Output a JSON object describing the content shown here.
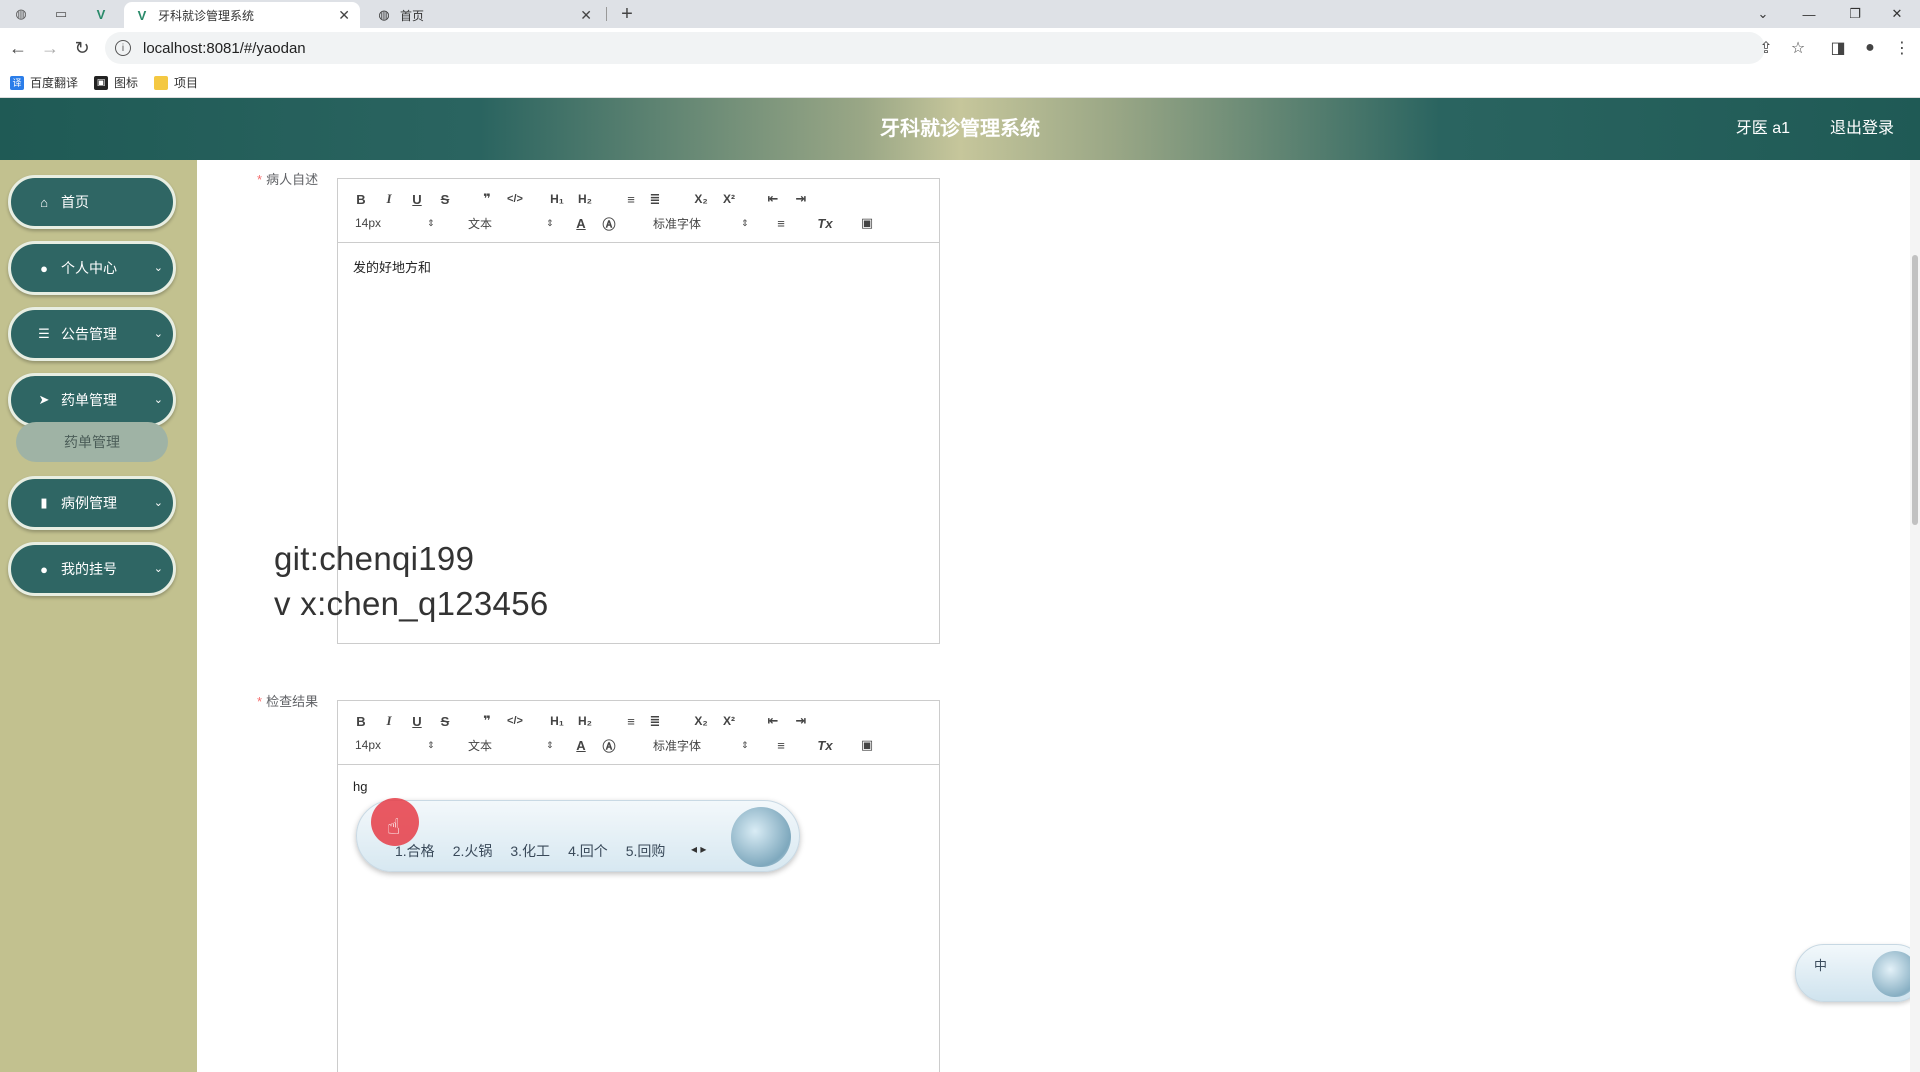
{
  "browser": {
    "tabs": [
      {
        "title": "牙科就诊管理系统",
        "active": true
      },
      {
        "title": "首页",
        "active": false
      }
    ],
    "url": "localhost:8081/#/yaodan",
    "bookmarks": [
      {
        "label": "百度翻译",
        "icon": "translate-icon"
      },
      {
        "label": "图标",
        "icon": "image-icon"
      },
      {
        "label": "项目",
        "icon": "folder-icon"
      }
    ]
  },
  "header": {
    "title": "牙科就诊管理系统",
    "user": "牙医 a1",
    "logout": "退出登录"
  },
  "sidebar": {
    "items": [
      {
        "label": "首页",
        "icon": "home-icon"
      },
      {
        "label": "个人中心",
        "icon": "user-icon"
      },
      {
        "label": "公告管理",
        "icon": "list-icon"
      },
      {
        "label": "药单管理",
        "icon": "send-icon"
      },
      {
        "label": "病例管理",
        "icon": "bar-chart-icon"
      },
      {
        "label": "我的挂号",
        "icon": "map-pin-icon"
      }
    ],
    "sub_item": "药单管理"
  },
  "form": {
    "field1": {
      "label": "病人自述",
      "content": "发的好地方和"
    },
    "field2": {
      "label": "检查结果",
      "content": "hg"
    },
    "toolbar": {
      "size": "14px",
      "header": "文本",
      "font": "标准字体"
    }
  },
  "watermark": {
    "line1": "git:chenqi199",
    "line2": "v x:chen_q123456"
  },
  "ime": {
    "candidates": [
      "1.合格",
      "2.火锅",
      "3.化工",
      "4.回个",
      "5.回购"
    ],
    "float_label": "中"
  },
  "colors": {
    "sidebar_bg": "#c2c18f",
    "menu_pill": "#2f6664",
    "header_dark": "#1f5a55",
    "required": "#f56c6c"
  }
}
